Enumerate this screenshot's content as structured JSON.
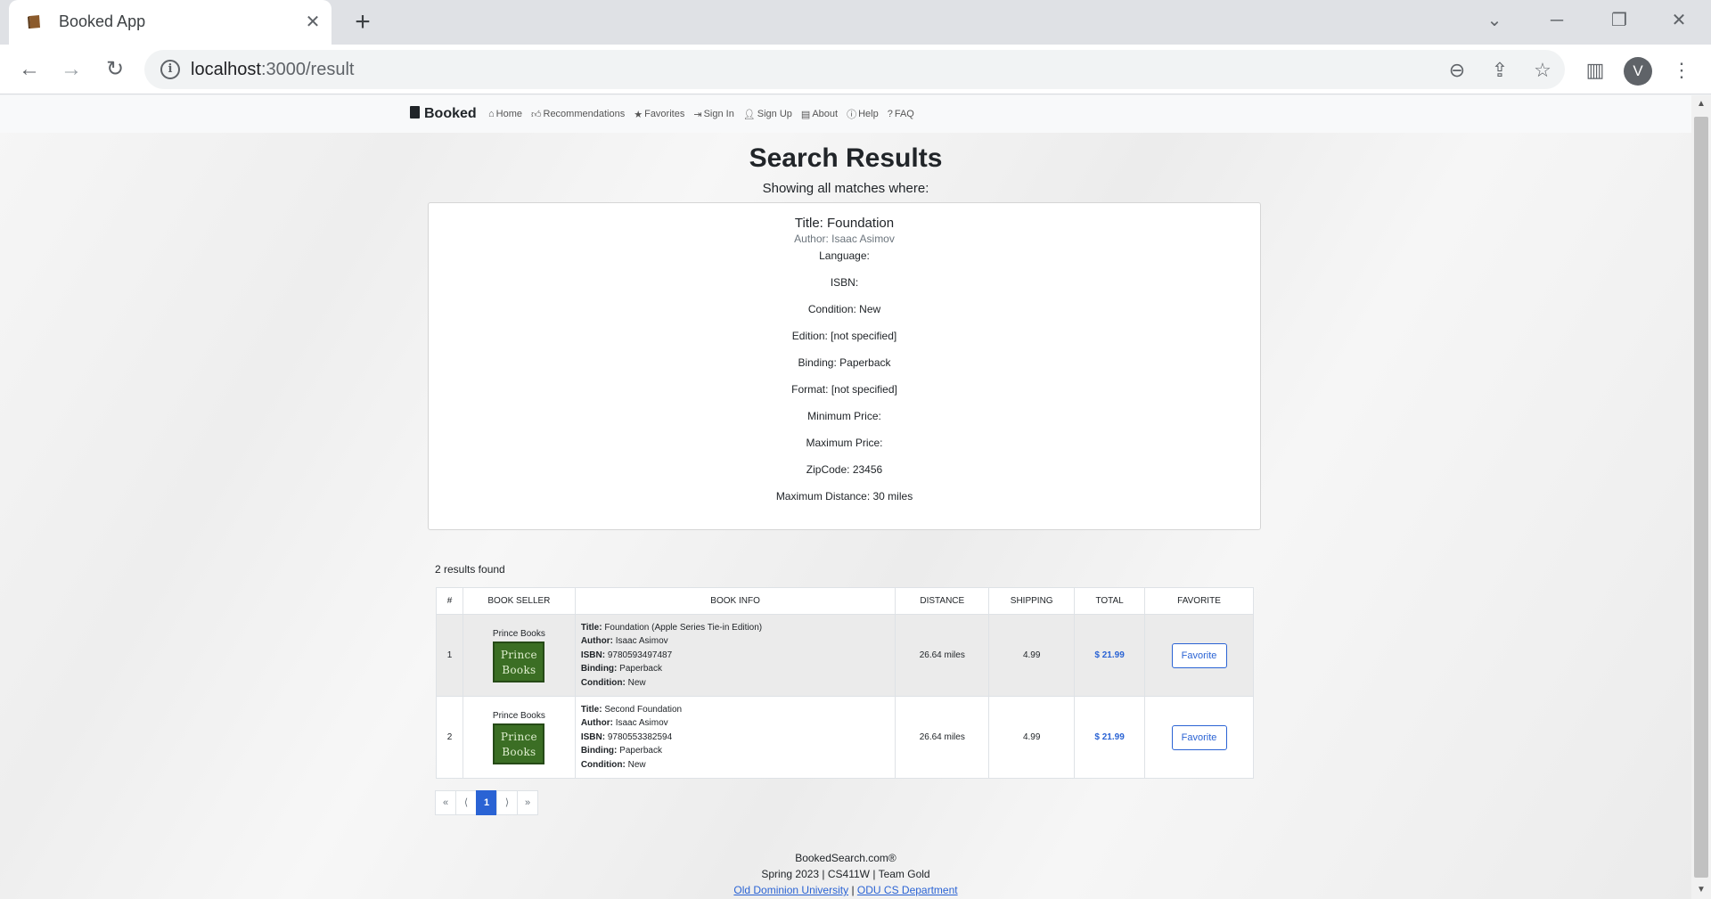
{
  "browser": {
    "tab_title": "Booked App",
    "new_tab": "+",
    "url_host": "localhost",
    "url_path": ":3000/result",
    "profile_initial": "V"
  },
  "navbar": {
    "brand": "Booked",
    "links": [
      "Home",
      "Recommendations",
      "Favorites",
      "Sign In",
      "Sign Up",
      "About",
      "Help",
      "FAQ"
    ]
  },
  "search": {
    "title": "Search Results",
    "subtitle": "Showing all matches where:",
    "criteria_title": "Title: Foundation",
    "criteria_author": "Author: Isaac Asimov",
    "criteria": [
      "Language:",
      "ISBN:",
      "Condition: New",
      "Edition: [not specified]",
      "Binding: Paperback",
      "Format: [not specified]",
      "Minimum Price:",
      "Maximum Price:",
      "ZipCode: 23456",
      "Maximum Distance: 30 miles"
    ]
  },
  "results": {
    "count_text": "2 results found",
    "headers": [
      "#",
      "BOOK SELLER",
      "BOOK INFO",
      "DISTANCE",
      "SHIPPING",
      "TOTAL",
      "FAVORITE"
    ],
    "field_labels": {
      "title": "Title:",
      "author": "Author:",
      "isbn": "ISBN:",
      "binding": "Binding:",
      "condition": "Condition:"
    },
    "seller_logo_line1": "Prince",
    "seller_logo_line2": "Books",
    "rows": [
      {
        "num": "1",
        "seller": "Prince Books",
        "title": "Foundation (Apple Series Tie-in Edition)",
        "author": "Isaac Asimov",
        "isbn": "9780593497487",
        "binding": "Paperback",
        "condition": "New",
        "distance": "26.64 miles",
        "shipping": "4.99",
        "total": "$ 21.99",
        "favorite_label": "Favorite"
      },
      {
        "num": "2",
        "seller": "Prince Books",
        "title": "Second Foundation",
        "author": "Isaac Asimov",
        "isbn": "9780553382594",
        "binding": "Paperback",
        "condition": "New",
        "distance": "26.64 miles",
        "shipping": "4.99",
        "total": "$ 21.99",
        "favorite_label": "Favorite"
      }
    ]
  },
  "pagination": {
    "first": "«",
    "prev": "⟨",
    "current": "1",
    "next": "⟩",
    "last": "»"
  },
  "footer": {
    "line1": "BookedSearch.com®",
    "line2": "Spring 2023 | CS411W | Team Gold",
    "link1": "Old Dominion University",
    "separator": "|",
    "link2": "ODU CS Department"
  }
}
